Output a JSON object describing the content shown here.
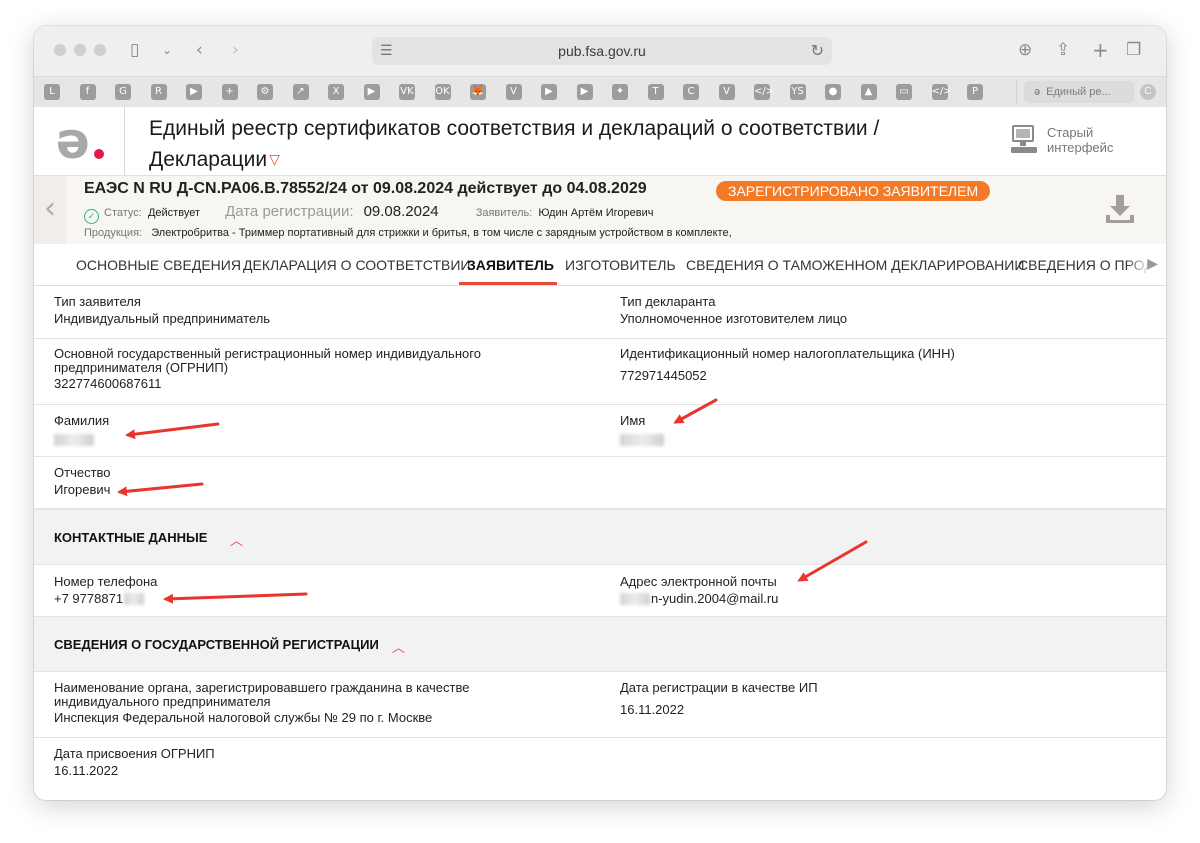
{
  "browser": {
    "url": "pub.fsa.gov.ru",
    "tab_title": "Единый ре...",
    "favorites": [
      "L",
      "f",
      "G",
      "R",
      "▶",
      "+",
      "⚙",
      "↗",
      "X",
      "▶",
      "VK",
      "OK",
      "🦊",
      "V",
      "▶",
      "▶",
      "✦",
      "T",
      "C",
      "V",
      "</>",
      "YS",
      "●",
      "▲",
      "▭",
      "</>",
      "P"
    ]
  },
  "header": {
    "title_line1": "Единый реестр сертификатов соответствия и деклараций о соответствии /",
    "title_line2": "Декларации",
    "old_interface_line1": "Старый",
    "old_interface_line2": "интерфейс"
  },
  "declaration": {
    "number": "ЕАЭС N RU Д-CN.РА06.В.78552/24 от 09.08.2024 действует до 04.08.2029",
    "badge": "ЗАРЕГИСТРИРОВАНО ЗАЯВИТЕЛЕМ",
    "status_label": "Статус:",
    "status_value": "Действует",
    "reg_date_label": "Дата регистрации:",
    "reg_date_value": "09.08.2024",
    "applicant_label": "Заявитель:",
    "applicant_value": "Юдин Артём Игоревич",
    "product_label": "Продукция:",
    "product_value": "Электробритва - Триммер портативный для стрижки и бритья, в том числе с зарядным устройством в комплекте,"
  },
  "tabs": [
    {
      "label": "ОСНОВНЫЕ СВЕДЕНИЯ"
    },
    {
      "label": "ДЕКЛАРАЦИЯ О СООТВЕТСТВИИ"
    },
    {
      "label": "ЗАЯВИТЕЛЬ"
    },
    {
      "label": "ИЗГОТОВИТЕЛЬ"
    },
    {
      "label": "СВЕДЕНИЯ О ТАМОЖЕННОМ ДЕКЛАРИРОВАНИИ"
    },
    {
      "label": "СВЕДЕНИЯ О ПРОДУ"
    }
  ],
  "applicant": {
    "type_label": "Тип заявителя",
    "type_value": "Индивидуальный предприниматель",
    "declarant_label": "Тип декларанта",
    "declarant_value": "Уполномоченное изготовителем лицо",
    "ogrnip_label_1": "Основной государственный регистрационный номер индивидуального",
    "ogrnip_label_2": "предпринимателя (ОГРНИП)",
    "ogrnip_value": "322774600687611",
    "inn_label": "Идентификационный номер налогоплательщика (ИНН)",
    "inn_value": "772971445052",
    "surname_label": "Фамилия",
    "name_label": "Имя",
    "patronymic_label": "Отчество",
    "patronymic_value": "Игоревич"
  },
  "contacts": {
    "section_title": "КОНТАКТНЫЕ ДАННЫЕ",
    "phone_label": "Номер телефона",
    "phone_value": "+7 9778871",
    "email_label": "Адрес электронной почты",
    "email_value": "n-yudin.2004@mail.ru"
  },
  "registration": {
    "section_title": "СВЕДЕНИЯ О ГОСУДАРСТВЕННОЙ РЕГИСТРАЦИИ",
    "authority_label_1": "Наименование органа, зарегистрировавшего гражданина в качестве",
    "authority_label_2": "индивидуального предпринимателя",
    "authority_value": "Инспекция Федеральной налоговой службы № 29 по г. Москве",
    "ip_date_label": "Дата регистрации в качестве ИП",
    "ip_date_value": "16.11.2022",
    "ogrnip_date_label": "Дата присвоения ОГРНИП",
    "ogrnip_date_value": "16.11.2022"
  },
  "colors": {
    "accent": "#e34b3a",
    "badge": "#f17b28",
    "annotation_arrow": "#e8362c"
  }
}
